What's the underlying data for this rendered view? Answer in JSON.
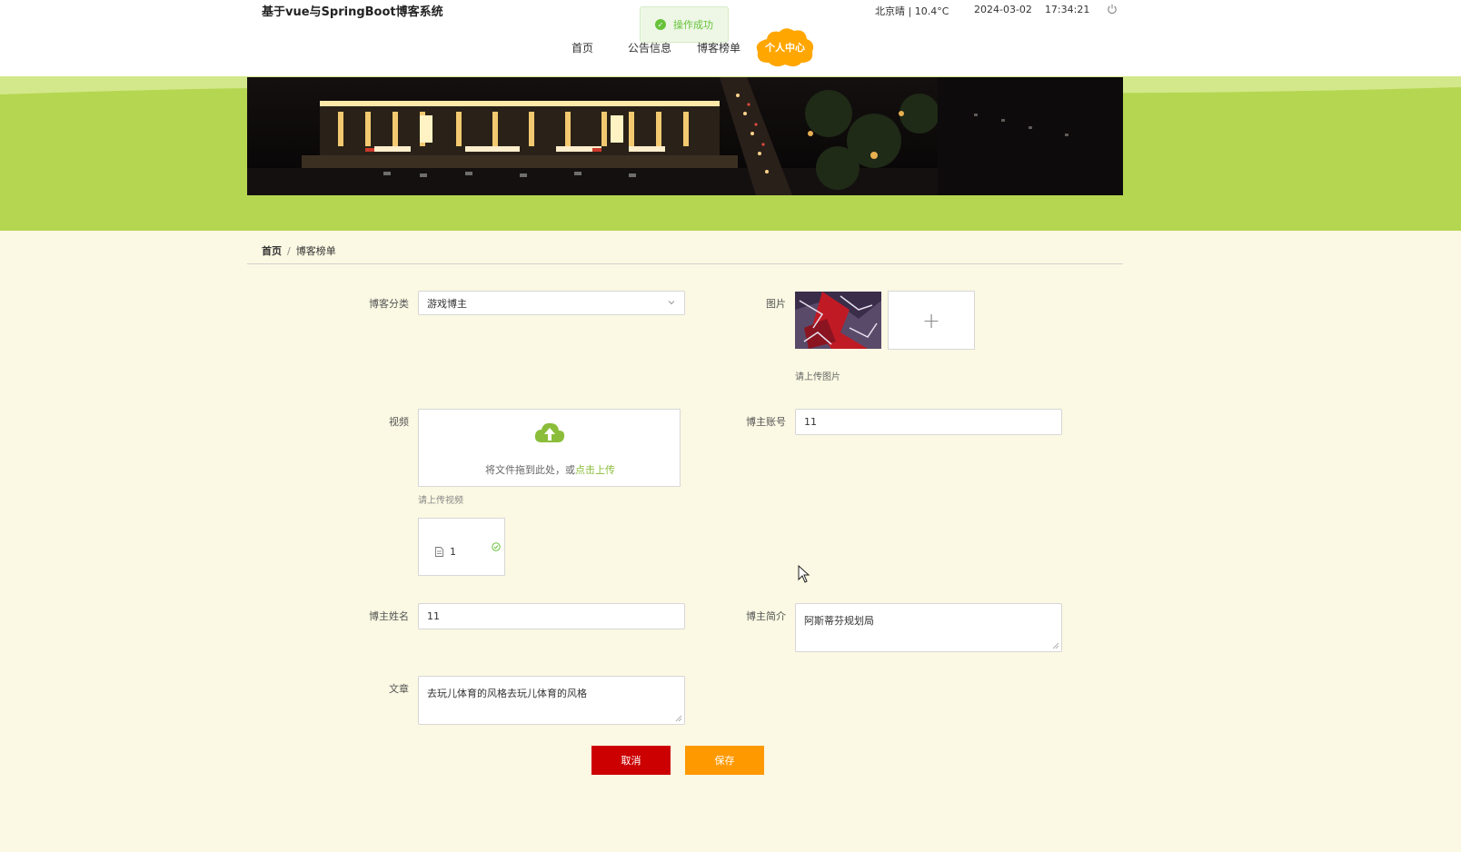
{
  "header": {
    "title": "基于vue与SpringBoot博客系统",
    "toast": "操作成功",
    "weather": "北京晴 | 10.4°C",
    "date": "2024-03-02",
    "time": "17:34:21"
  },
  "nav": {
    "items": [
      {
        "label": "首页"
      },
      {
        "label": "公告信息"
      },
      {
        "label": "博客榜单"
      }
    ],
    "active_label": "个人中心"
  },
  "breadcrumb": {
    "home": "首页",
    "separator": "/",
    "current": "博客榜单"
  },
  "form": {
    "category": {
      "label": "博客分类",
      "value": "游戏博主"
    },
    "image": {
      "label": "图片",
      "add_symbol": "+",
      "hint": "请上传图片"
    },
    "video": {
      "label": "视频",
      "drag_text": "将文件拖到此处，或",
      "link_text": "点击上传",
      "hint": "请上传视频",
      "file_name": "1"
    },
    "account": {
      "label": "博主账号",
      "value": "11"
    },
    "name": {
      "label": "博主姓名",
      "value": "11"
    },
    "intro": {
      "label": "博主简介",
      "value": "阿斯蒂芬规划局"
    },
    "article": {
      "label": "文章",
      "value": "去玩儿体育的风格去玩儿体育的风格"
    }
  },
  "buttons": {
    "cancel": "取消",
    "save": "保存"
  },
  "colors": {
    "accent_green": "#b5d651",
    "page_bg": "#fbf9e3",
    "cancel": "#cc0000",
    "save": "#ff9900",
    "nav_active": "#ffa600"
  }
}
